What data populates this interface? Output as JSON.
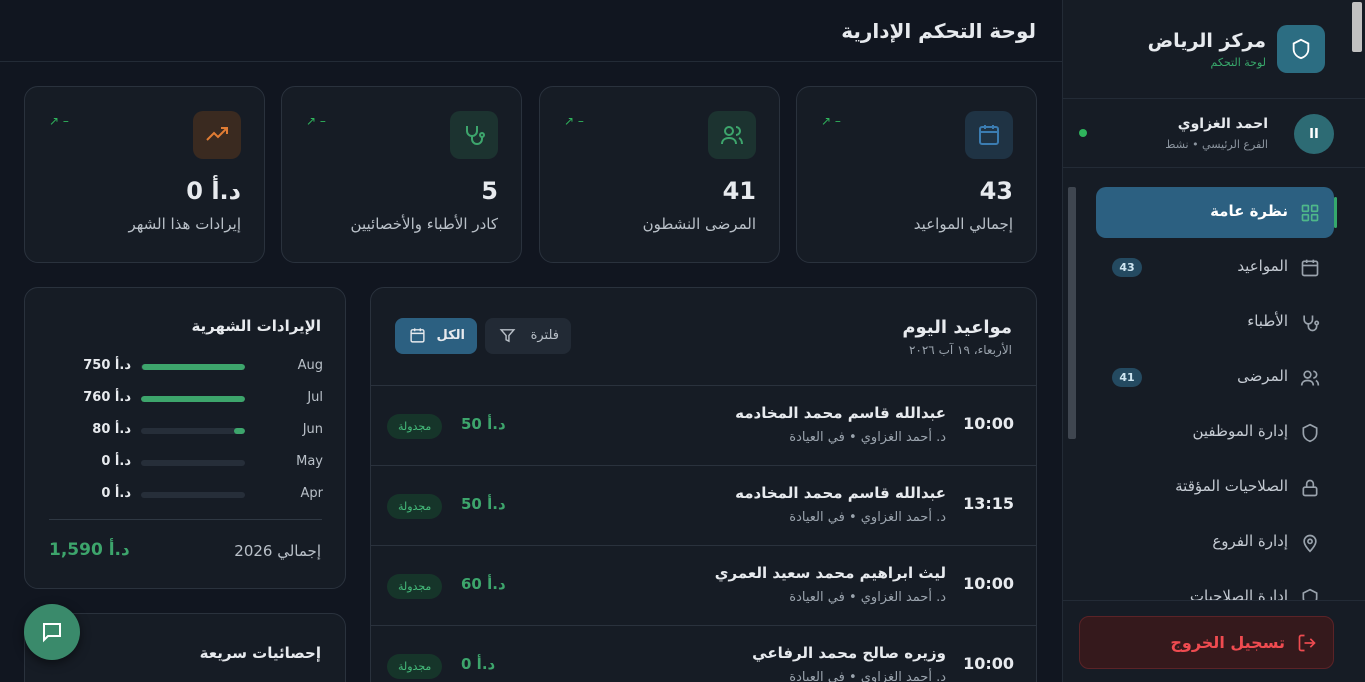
{
  "header": {
    "title": "لوحة التحكم الإدارية"
  },
  "sidebar": {
    "brand_title": "مركز الرياض",
    "brand_subtitle": "لوحة التحكم",
    "user": {
      "initials": "II",
      "name": "احمد الغزاوي",
      "subtitle": "الفرع الرئيسي • نشط"
    },
    "items": [
      {
        "label": "نظرة عامة",
        "icon": "grid-icon",
        "active": true
      },
      {
        "label": "المواعيد",
        "icon": "calendar-icon",
        "badge": "43"
      },
      {
        "label": "الأطباء",
        "icon": "stethoscope-icon"
      },
      {
        "label": "المرضى",
        "icon": "users-icon",
        "badge": "41"
      },
      {
        "label": "إدارة الموظفين",
        "icon": "shield-icon"
      },
      {
        "label": "الصلاحيات المؤقتة",
        "icon": "lock-icon"
      },
      {
        "label": "إدارة الفروع",
        "icon": "map-pin-icon"
      },
      {
        "label": "إدارة الصلاحيات",
        "icon": "shield-icon"
      }
    ],
    "logout_label": "تسجيل الخروج"
  },
  "stats": [
    {
      "value": "43",
      "label": "إجمالي المواعيد",
      "trend": "↗ –",
      "icon": "calendar-icon",
      "color": "#3b7cb1"
    },
    {
      "value": "41",
      "label": "المرضى النشطون",
      "trend": "↗ –",
      "icon": "users-icon",
      "color": "#3da56c"
    },
    {
      "value": "5",
      "label": "كادر الأطباء والأخصائيين",
      "trend": "↗ –",
      "icon": "stethoscope-icon",
      "color": "#3da56c"
    },
    {
      "value": "0 د.أ",
      "label": "إيرادات هذا الشهر",
      "trend": "↗ –",
      "icon": "trending-up-icon",
      "color": "#e07c34"
    }
  ],
  "appointments": {
    "title": "مواعيد اليوم",
    "date": "الأربعاء، ١٩ آب ٢٠٢٦",
    "all_label": "الكل",
    "filter_label": "فلترة",
    "rows": [
      {
        "time": "10:00",
        "name": "عبدالله قاسم محمد المخادمه",
        "doctor": "د. أحمد الغزاوي • في العيادة",
        "fee": "50 د.أ",
        "status": "مجدولة"
      },
      {
        "time": "13:15",
        "name": "عبدالله قاسم محمد المخادمه",
        "doctor": "د. أحمد الغزاوي • في العيادة",
        "fee": "50 د.أ",
        "status": "مجدولة"
      },
      {
        "time": "10:00",
        "name": "ليث ابراهيم محمد سعيد العمري",
        "doctor": "د. أحمد الغزاوي • في العيادة",
        "fee": "60 د.أ",
        "status": "مجدولة"
      },
      {
        "time": "10:00",
        "name": "وزيره صالح محمد الرفاعي",
        "doctor": "د. أحمد الغزاوي • في العيادة",
        "fee": "0 د.أ",
        "status": "مجدولة"
      }
    ]
  },
  "revenue": {
    "title": "الإيرادات الشهرية",
    "months": [
      {
        "month": "Aug",
        "amount": "750 د.أ",
        "value": 750
      },
      {
        "month": "Jul",
        "amount": "760 د.أ",
        "value": 760
      },
      {
        "month": "Jun",
        "amount": "80 د.أ",
        "value": 80
      },
      {
        "month": "May",
        "amount": "0 د.أ",
        "value": 0
      },
      {
        "month": "Apr",
        "amount": "0 د.أ",
        "value": 0
      }
    ],
    "total_label": "إجمالي 2026",
    "total_value": "1,590 د.أ"
  },
  "quick_stats": {
    "title": "إحصائيات سريعة"
  }
}
